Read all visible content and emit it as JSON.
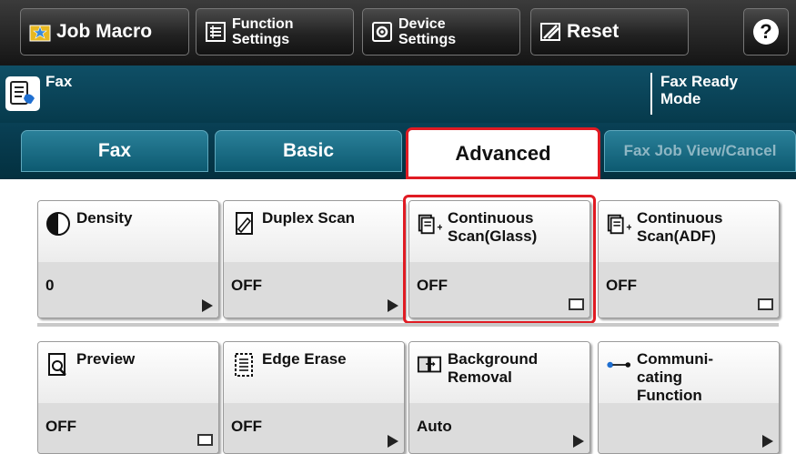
{
  "toolbar": {
    "job_macro": "Job Macro",
    "function_settings": "Function\nSettings",
    "device_settings": "Device\nSettings",
    "reset": "Reset",
    "help_icon": "question-mark"
  },
  "header": {
    "title": "Fax",
    "mode": "Fax Ready\nMode"
  },
  "tabs": [
    {
      "label": "Fax",
      "state": "inactive"
    },
    {
      "label": "Basic",
      "state": "inactive"
    },
    {
      "label": "Advanced",
      "state": "active"
    },
    {
      "label": "Fax Job View/Cancel",
      "state": "disabled"
    }
  ],
  "settings": [
    {
      "name": "Density",
      "value": "0",
      "icon": "contrast-icon",
      "indicator": "arrow"
    },
    {
      "name": "Duplex Scan",
      "value": "OFF",
      "icon": "duplex-icon",
      "indicator": "arrow"
    },
    {
      "name": "Continuous\nScan(Glass)",
      "value": "OFF",
      "icon": "continuous-scan-icon",
      "indicator": "checkbox",
      "highlighted": true
    },
    {
      "name": "Continuous\nScan(ADF)",
      "value": "OFF",
      "icon": "continuous-scan-icon",
      "indicator": "checkbox"
    },
    {
      "name": "Preview",
      "value": "OFF",
      "icon": "preview-icon",
      "indicator": "checkbox"
    },
    {
      "name": "Edge Erase",
      "value": "OFF",
      "icon": "edge-erase-icon",
      "indicator": "arrow"
    },
    {
      "name": "Background\nRemoval",
      "value": "Auto",
      "icon": "background-removal-icon",
      "indicator": "arrow"
    },
    {
      "name": "Communi-\ncating\nFunction",
      "value": "",
      "icon": "communicating-icon",
      "indicator": "arrow"
    }
  ],
  "colors": {
    "accent_red": "#e01b23",
    "header_teal": "#0f4f66",
    "tab_teal": "#1f7390"
  }
}
